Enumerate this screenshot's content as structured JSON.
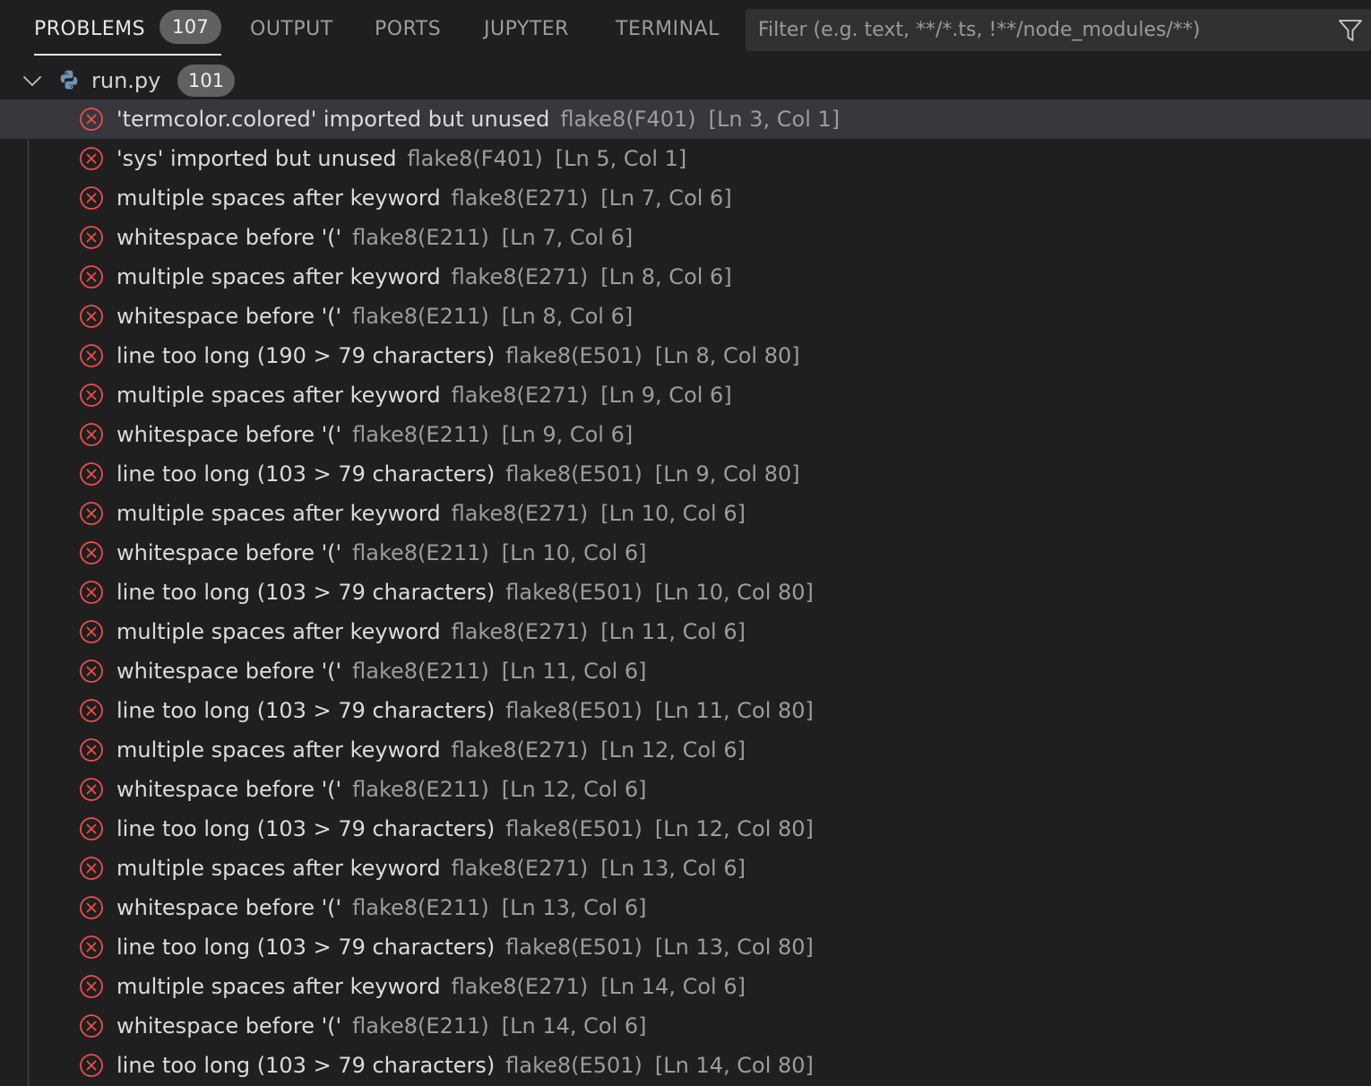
{
  "tabs": [
    {
      "label": "PROBLEMS",
      "badge": "107",
      "active": true
    },
    {
      "label": "OUTPUT"
    },
    {
      "label": "PORTS"
    },
    {
      "label": "JUPYTER"
    },
    {
      "label": "TERMINAL"
    }
  ],
  "filter": {
    "placeholder": "Filter (e.g. text, **/*.ts, !**/node_modules/**)",
    "icon": "filter-icon"
  },
  "file": {
    "name": "run.py",
    "count": "101",
    "icon": "python-icon",
    "expanded": true
  },
  "colors": {
    "error": "#f14c4c",
    "background": "#1f1f1f",
    "selected_row": "#37373d",
    "badge": "#616161"
  },
  "problems": [
    {
      "message": "'termcolor.colored' imported but unused",
      "source": "flake8(F401)",
      "location": "[Ln 3, Col 1]"
    },
    {
      "message": "'sys' imported but unused",
      "source": "flake8(F401)",
      "location": "[Ln 5, Col 1]"
    },
    {
      "message": "multiple spaces after keyword",
      "source": "flake8(E271)",
      "location": "[Ln 7, Col 6]"
    },
    {
      "message": "whitespace before '('",
      "source": "flake8(E211)",
      "location": "[Ln 7, Col 6]"
    },
    {
      "message": "multiple spaces after keyword",
      "source": "flake8(E271)",
      "location": "[Ln 8, Col 6]"
    },
    {
      "message": "whitespace before '('",
      "source": "flake8(E211)",
      "location": "[Ln 8, Col 6]"
    },
    {
      "message": "line too long (190 > 79 characters)",
      "source": "flake8(E501)",
      "location": "[Ln 8, Col 80]"
    },
    {
      "message": "multiple spaces after keyword",
      "source": "flake8(E271)",
      "location": "[Ln 9, Col 6]"
    },
    {
      "message": "whitespace before '('",
      "source": "flake8(E211)",
      "location": "[Ln 9, Col 6]"
    },
    {
      "message": "line too long (103 > 79 characters)",
      "source": "flake8(E501)",
      "location": "[Ln 9, Col 80]"
    },
    {
      "message": "multiple spaces after keyword",
      "source": "flake8(E271)",
      "location": "[Ln 10, Col 6]"
    },
    {
      "message": "whitespace before '('",
      "source": "flake8(E211)",
      "location": "[Ln 10, Col 6]"
    },
    {
      "message": "line too long (103 > 79 characters)",
      "source": "flake8(E501)",
      "location": "[Ln 10, Col 80]"
    },
    {
      "message": "multiple spaces after keyword",
      "source": "flake8(E271)",
      "location": "[Ln 11, Col 6]"
    },
    {
      "message": "whitespace before '('",
      "source": "flake8(E211)",
      "location": "[Ln 11, Col 6]"
    },
    {
      "message": "line too long (103 > 79 characters)",
      "source": "flake8(E501)",
      "location": "[Ln 11, Col 80]"
    },
    {
      "message": "multiple spaces after keyword",
      "source": "flake8(E271)",
      "location": "[Ln 12, Col 6]"
    },
    {
      "message": "whitespace before '('",
      "source": "flake8(E211)",
      "location": "[Ln 12, Col 6]"
    },
    {
      "message": "line too long (103 > 79 characters)",
      "source": "flake8(E501)",
      "location": "[Ln 12, Col 80]"
    },
    {
      "message": "multiple spaces after keyword",
      "source": "flake8(E271)",
      "location": "[Ln 13, Col 6]"
    },
    {
      "message": "whitespace before '('",
      "source": "flake8(E211)",
      "location": "[Ln 13, Col 6]"
    },
    {
      "message": "line too long (103 > 79 characters)",
      "source": "flake8(E501)",
      "location": "[Ln 13, Col 80]"
    },
    {
      "message": "multiple spaces after keyword",
      "source": "flake8(E271)",
      "location": "[Ln 14, Col 6]"
    },
    {
      "message": "whitespace before '('",
      "source": "flake8(E211)",
      "location": "[Ln 14, Col 6]"
    },
    {
      "message": "line too long (103 > 79 characters)",
      "source": "flake8(E501)",
      "location": "[Ln 14, Col 80]"
    }
  ]
}
